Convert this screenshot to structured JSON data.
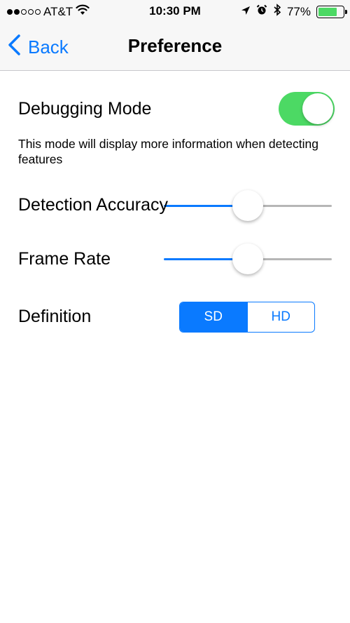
{
  "status_bar": {
    "carrier": "AT&T",
    "time": "10:30 PM",
    "battery_percent": "77%",
    "battery_level": 0.77,
    "signal_bars_filled": 2,
    "signal_bars_total": 5,
    "icons": [
      "wifi-icon",
      "location-icon",
      "alarm-icon",
      "bluetooth-icon"
    ]
  },
  "nav": {
    "back_label": "Back",
    "title": "Preference"
  },
  "settings": {
    "debugging_mode": {
      "label": "Debugging Mode",
      "enabled": true,
      "description": "This mode will display more information when detecting features"
    },
    "detection_accuracy": {
      "label": "Detection Accuracy",
      "value": 0.5
    },
    "frame_rate": {
      "label": "Frame Rate",
      "value": 0.5
    },
    "definition": {
      "label": "Definition",
      "options": [
        "SD",
        "HD"
      ],
      "selected": "SD"
    }
  },
  "colors": {
    "accent": "#0a7aff",
    "toggle_on": "#4cd964",
    "track_inactive": "#b6b6b6"
  }
}
